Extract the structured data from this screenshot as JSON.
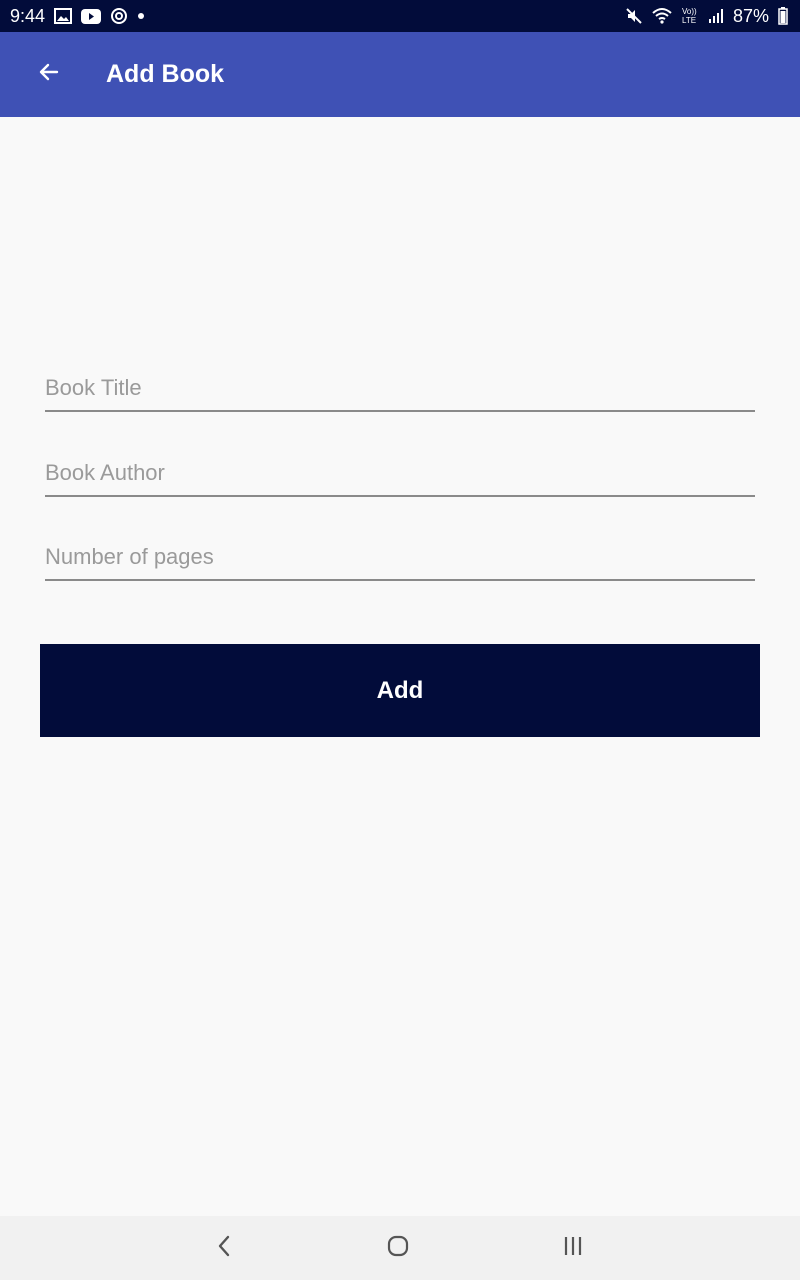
{
  "status_bar": {
    "time": "9:44",
    "battery": "87%",
    "notification_icons": [
      "image-icon",
      "youtube-icon",
      "sync-icon",
      "dot-icon"
    ],
    "system_icons": [
      "mute-icon",
      "wifi-icon",
      "volte-lte-icon",
      "signal-icon",
      "battery-icon"
    ]
  },
  "app_bar": {
    "title": "Add Book",
    "back_icon": "arrow-left-icon",
    "color": "#3f51b5"
  },
  "form": {
    "fields": [
      {
        "placeholder": "Book Title",
        "value": ""
      },
      {
        "placeholder": "Book Author",
        "value": ""
      },
      {
        "placeholder": "Number of pages",
        "value": ""
      }
    ],
    "submit_label": "Add",
    "submit_color": "#020c3a"
  },
  "nav_bar": {
    "buttons": [
      "back-icon",
      "home-icon",
      "recent-apps-icon"
    ]
  }
}
